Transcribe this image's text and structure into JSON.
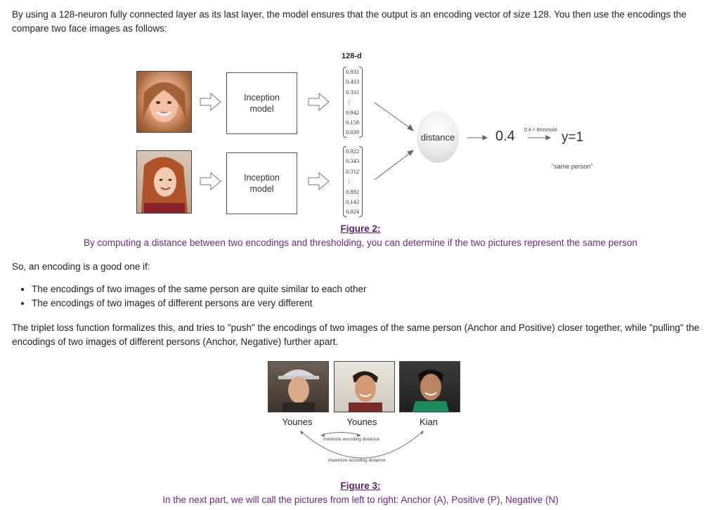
{
  "intro_text": "By using a 128-neuron fully connected layer as its last layer, the model ensures that the output is an encoding vector of size 128. You then use the encodings the compare two face images as follows:",
  "figure2": {
    "encoding_label": "128-d",
    "model_label_line1": "Inception",
    "model_label_line2": "model",
    "encoding_top": [
      "0.931",
      "0.433",
      "0.331",
      "⋮",
      "0.942",
      "0.158",
      "0.039"
    ],
    "encoding_bottom": [
      "0.922",
      "0.343",
      "0.312",
      "⋮",
      "0.892",
      "0.142",
      "0.024"
    ],
    "distance_label": "distance",
    "distance_value": "0.4",
    "threshold_note": "0.4 < threshold",
    "result": "y=1",
    "result_note": "\"same person\"",
    "title": "Figure 2:",
    "caption": "By computing a distance between two encodings and thresholding, you can determine if the two pictures represent the same person"
  },
  "so_text": "So, an encoding is a good one if:",
  "bullets": [
    "The encodings of two images of the same person are quite similar to each other",
    "The encodings of two images of different persons are very different"
  ],
  "triplet_text": "The triplet loss function formalizes this, and tries to \"push\" the encodings of two images of the same person (Anchor and Positive) closer together, while \"pulling\" the encodings of two images of different persons (Anchor, Negative) further apart.",
  "figure3": {
    "names": [
      "Younes",
      "Younes",
      "Kian"
    ],
    "minimize_label": "minimize encoding distance",
    "maximize_label": "maximize encoding distance",
    "title": "Figure 3:",
    "caption": "In the next part, we will call the pictures from left to right: Anchor (A), Positive (P), Negative (N)"
  }
}
